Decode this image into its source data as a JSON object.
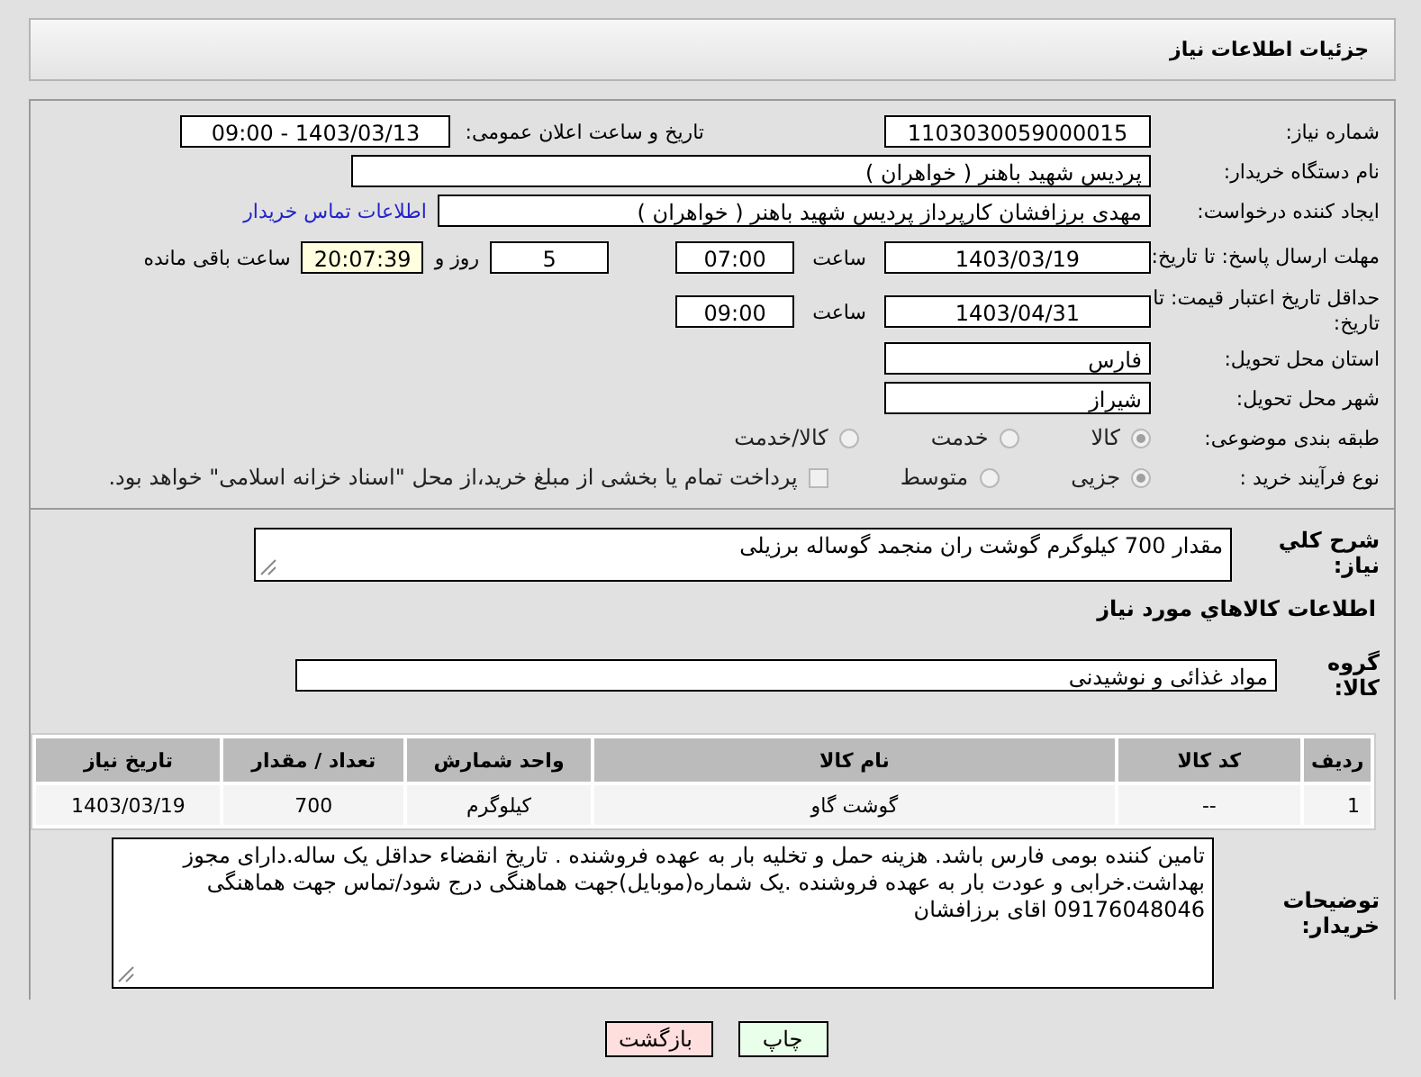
{
  "header": {
    "title": "جزئیات اطلاعات نیاز"
  },
  "form": {
    "need_number": {
      "label": "شماره نیاز:",
      "value": "1103030059000015"
    },
    "announce": {
      "label": "تاریخ و ساعت اعلان عمومی:",
      "value": "1403/03/13 - 09:00"
    },
    "buyer_org": {
      "label": "نام دستگاه خریدار:",
      "value": "پردیس شهید باهنر ( خواهران )"
    },
    "creator": {
      "label": "ایجاد کننده درخواست:",
      "value": "مهدی برزافشان کارپرداز پردیس شهید باهنر ( خواهران )",
      "contact_link": "اطلاعات تماس خریدار"
    },
    "response_deadline": {
      "label": "مهلت ارسال پاسخ: تا تاریخ:",
      "date": "1403/03/19",
      "time_label": "ساعت",
      "time": "07:00",
      "days": "5",
      "days_label": "روز و",
      "remaining": "20:07:39",
      "remaining_label": "ساعت باقی مانده"
    },
    "price_validity": {
      "label": "حداقل تاریخ اعتبار قیمت: تا تاریخ:",
      "date": "1403/04/31",
      "time_label": "ساعت",
      "time": "09:00"
    },
    "province": {
      "label": "استان محل تحویل:",
      "value": "فارس"
    },
    "city": {
      "label": "شهر محل تحویل:",
      "value": "شیراز"
    },
    "category": {
      "label": "طبقه بندی موضوعی:",
      "options": [
        {
          "label": "کالا",
          "selected": true
        },
        {
          "label": "خدمت",
          "selected": false
        },
        {
          "label": "کالا/خدمت",
          "selected": false
        }
      ]
    },
    "process": {
      "label": "نوع فرآیند خرید :",
      "options": [
        {
          "label": "جزیی",
          "selected": true
        },
        {
          "label": "متوسط",
          "selected": false
        }
      ],
      "payment_note": {
        "checked": false,
        "text": "پرداخت تمام یا بخشی از مبلغ خرید،از محل \"اسناد خزانه اسلامی\" خواهد بود."
      }
    }
  },
  "details": {
    "summary": {
      "label": "شرح کلي نياز:",
      "value": "مقدار 700 کیلوگرم گوشت ران منجمد گوساله برزیلی"
    },
    "goods_heading": "اطلاعات کالاهاي مورد نياز",
    "group": {
      "label": "گروه کالا:",
      "value": "مواد غذائی و نوشیدنی"
    },
    "table": {
      "columns": [
        "ردیف",
        "کد کالا",
        "نام کالا",
        "واحد شمارش",
        "تعداد / مقدار",
        "تاریخ نیاز"
      ],
      "rows": [
        [
          "1",
          "--",
          "گوشت گاو",
          "کیلوگرم",
          "700",
          "1403/03/19"
        ]
      ]
    },
    "buyer_notes": {
      "label": "توضیحات خریدار:",
      "value": "تامین کننده بومی فارس باشد. هزینه حمل و تخلیه بار به عهده فروشنده . تاریخ انقضاء حداقل یک ساله.دارای مجوز بهداشت.خرابی و عودت بار به عهده فروشنده  .یک شماره(موبایل)جهت هماهنگی درج شود/تماس جهت هماهنگی 09176048046 اقای برزافشان"
    }
  },
  "buttons": [
    {
      "label": "چاپ",
      "kind": "print"
    },
    {
      "label": "بازگشت",
      "kind": "back"
    }
  ]
}
